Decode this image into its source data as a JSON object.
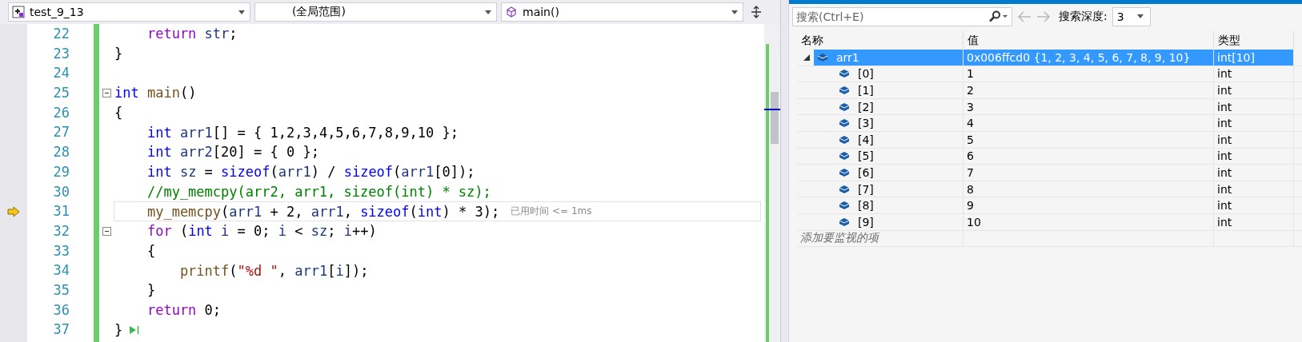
{
  "editor": {
    "navigation": [
      {
        "kind": "project",
        "text": "test_9_13"
      },
      {
        "kind": "scope",
        "text": "(全局范围)"
      },
      {
        "kind": "member",
        "text": "main()"
      }
    ],
    "lines": [
      {
        "number": "22",
        "current": false,
        "foldable": false,
        "run_to_here": false,
        "tokens": [
          {
            "kind": "control",
            "text": "    return"
          },
          {
            "kind": "variable",
            "text": " str"
          },
          {
            "kind": "plain",
            "text": ";"
          }
        ]
      },
      {
        "number": "23",
        "current": false,
        "foldable": false,
        "run_to_here": false,
        "tokens": [
          {
            "kind": "plain",
            "text": "}"
          }
        ]
      },
      {
        "number": "24",
        "current": false,
        "foldable": false,
        "run_to_here": false
      },
      {
        "number": "25",
        "current": false,
        "foldable": true,
        "run_to_here": false,
        "tokens": [
          {
            "kind": "keyword",
            "text": "int"
          },
          {
            "kind": "function",
            "text": " main"
          },
          {
            "kind": "plain",
            "text": "()"
          }
        ]
      },
      {
        "number": "26",
        "current": false,
        "foldable": false,
        "run_to_here": false,
        "tokens": [
          {
            "kind": "plain",
            "text": "{"
          }
        ]
      },
      {
        "number": "27",
        "current": false,
        "foldable": false,
        "run_to_here": false,
        "tokens": [
          {
            "kind": "keyword",
            "text": "    int"
          },
          {
            "kind": "variable",
            "text": " arr1"
          },
          {
            "kind": "plain",
            "text": "[] = { 1,2,3,4,5,6,7,8,9,10 };"
          }
        ]
      },
      {
        "number": "28",
        "current": false,
        "foldable": false,
        "run_to_here": false,
        "tokens": [
          {
            "kind": "keyword",
            "text": "    int"
          },
          {
            "kind": "variable",
            "text": " arr2"
          },
          {
            "kind": "plain",
            "text": "[20] = { 0 };"
          }
        ]
      },
      {
        "number": "29",
        "current": false,
        "foldable": false,
        "run_to_here": false,
        "tokens": [
          {
            "kind": "keyword",
            "text": "    int"
          },
          {
            "kind": "variable",
            "text": " sz"
          },
          {
            "kind": "plain",
            "text": " = "
          },
          {
            "kind": "keyword",
            "text": "sizeof"
          },
          {
            "kind": "plain",
            "text": "("
          },
          {
            "kind": "variable",
            "text": "arr1"
          },
          {
            "kind": "plain",
            "text": ") / "
          },
          {
            "kind": "keyword",
            "text": "sizeof"
          },
          {
            "kind": "plain",
            "text": "("
          },
          {
            "kind": "variable",
            "text": "arr1"
          },
          {
            "kind": "plain",
            "text": "[0]);"
          }
        ]
      },
      {
        "number": "30",
        "current": false,
        "foldable": false,
        "run_to_here": false,
        "tokens": [
          {
            "kind": "comment",
            "text": "    //my_memcpy(arr2, arr1, sizeof(int) * sz);"
          }
        ]
      },
      {
        "number": "31",
        "current": true,
        "foldable": false,
        "run_to_here": false,
        "tokens": [
          {
            "kind": "function",
            "text": "    my_memcpy"
          },
          {
            "kind": "plain",
            "text": "("
          },
          {
            "kind": "variable",
            "text": "arr1"
          },
          {
            "kind": "plain",
            "text": " + 2, "
          },
          {
            "kind": "variable",
            "text": "arr1"
          },
          {
            "kind": "plain",
            "text": ", "
          },
          {
            "kind": "keyword",
            "text": "sizeof"
          },
          {
            "kind": "plain",
            "text": "("
          },
          {
            "kind": "keyword",
            "text": "int"
          },
          {
            "kind": "plain",
            "text": ") * 3);"
          }
        ],
        "perf_tip": "已用时间 <= 1ms"
      },
      {
        "number": "32",
        "current": false,
        "foldable": true,
        "run_to_here": false,
        "tokens": [
          {
            "kind": "control",
            "text": "    for"
          },
          {
            "kind": "plain",
            "text": " ("
          },
          {
            "kind": "keyword",
            "text": "int"
          },
          {
            "kind": "variable",
            "text": " i"
          },
          {
            "kind": "plain",
            "text": " = 0; "
          },
          {
            "kind": "variable",
            "text": "i"
          },
          {
            "kind": "plain",
            "text": " < "
          },
          {
            "kind": "variable",
            "text": "sz"
          },
          {
            "kind": "plain",
            "text": "; "
          },
          {
            "kind": "variable",
            "text": "i"
          },
          {
            "kind": "plain",
            "text": "++)"
          }
        ]
      },
      {
        "number": "33",
        "current": false,
        "foldable": false,
        "run_to_here": false,
        "tokens": [
          {
            "kind": "plain",
            "text": "    {"
          }
        ]
      },
      {
        "number": "34",
        "current": false,
        "foldable": false,
        "run_to_here": false,
        "tokens": [
          {
            "kind": "function",
            "text": "        printf"
          },
          {
            "kind": "plain",
            "text": "("
          },
          {
            "kind": "string",
            "text": "\"%d \""
          },
          {
            "kind": "plain",
            "text": ", "
          },
          {
            "kind": "variable",
            "text": "arr1"
          },
          {
            "kind": "plain",
            "text": "["
          },
          {
            "kind": "variable",
            "text": "i"
          },
          {
            "kind": "plain",
            "text": "]);"
          }
        ]
      },
      {
        "number": "35",
        "current": false,
        "foldable": false,
        "run_to_here": false,
        "tokens": [
          {
            "kind": "plain",
            "text": "    }"
          }
        ]
      },
      {
        "number": "36",
        "current": false,
        "foldable": false,
        "run_to_here": false,
        "tokens": [
          {
            "kind": "control",
            "text": "    return"
          },
          {
            "kind": "plain",
            "text": " 0;"
          }
        ]
      },
      {
        "number": "37",
        "current": false,
        "foldable": false,
        "run_to_here": true,
        "tokens": [
          {
            "kind": "plain",
            "text": "}"
          }
        ]
      }
    ]
  },
  "watch": {
    "search": {
      "placeholder": "搜索(Ctrl+E)"
    },
    "depth_label": "搜索深度:",
    "depth": "3",
    "columns": [
      "名称",
      "值",
      "类型"
    ],
    "rows": [
      {
        "name": "arr1",
        "value": "0x006ffcd0 {1, 2, 3, 4, 5, 6, 7, 8, 9, 10}",
        "type": "int[10]",
        "selected": true,
        "expanded": true,
        "children": [
          {
            "name": "[0]",
            "value": "1",
            "type": "int",
            "selected": false
          },
          {
            "name": "[1]",
            "value": "2",
            "type": "int",
            "selected": false
          },
          {
            "name": "[2]",
            "value": "3",
            "type": "int",
            "selected": false
          },
          {
            "name": "[3]",
            "value": "4",
            "type": "int",
            "selected": false
          },
          {
            "name": "[4]",
            "value": "5",
            "type": "int",
            "selected": false
          },
          {
            "name": "[5]",
            "value": "6",
            "type": "int",
            "selected": false
          },
          {
            "name": "[6]",
            "value": "7",
            "type": "int",
            "selected": false
          },
          {
            "name": "[7]",
            "value": "8",
            "type": "int",
            "selected": false
          },
          {
            "name": "[8]",
            "value": "9",
            "type": "int",
            "selected": false
          },
          {
            "name": "[9]",
            "value": "10",
            "type": "int",
            "selected": false
          }
        ]
      }
    ],
    "add_placeholder": "添加要监视的项"
  }
}
